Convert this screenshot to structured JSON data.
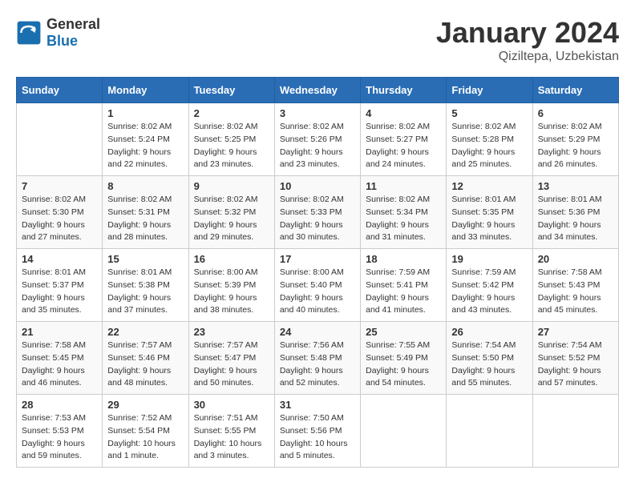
{
  "header": {
    "logo_general": "General",
    "logo_blue": "Blue",
    "month_title": "January 2024",
    "location": "Qiziltepa, Uzbekistan"
  },
  "weekdays": [
    "Sunday",
    "Monday",
    "Tuesday",
    "Wednesday",
    "Thursday",
    "Friday",
    "Saturday"
  ],
  "weeks": [
    [
      null,
      {
        "day": 1,
        "sunrise": "8:02 AM",
        "sunset": "5:24 PM",
        "daylight": "9 hours and 22 minutes."
      },
      {
        "day": 2,
        "sunrise": "8:02 AM",
        "sunset": "5:25 PM",
        "daylight": "9 hours and 23 minutes."
      },
      {
        "day": 3,
        "sunrise": "8:02 AM",
        "sunset": "5:26 PM",
        "daylight": "9 hours and 23 minutes."
      },
      {
        "day": 4,
        "sunrise": "8:02 AM",
        "sunset": "5:27 PM",
        "daylight": "9 hours and 24 minutes."
      },
      {
        "day": 5,
        "sunrise": "8:02 AM",
        "sunset": "5:28 PM",
        "daylight": "9 hours and 25 minutes."
      },
      {
        "day": 6,
        "sunrise": "8:02 AM",
        "sunset": "5:29 PM",
        "daylight": "9 hours and 26 minutes."
      }
    ],
    [
      {
        "day": 7,
        "sunrise": "8:02 AM",
        "sunset": "5:30 PM",
        "daylight": "9 hours and 27 minutes."
      },
      {
        "day": 8,
        "sunrise": "8:02 AM",
        "sunset": "5:31 PM",
        "daylight": "9 hours and 28 minutes."
      },
      {
        "day": 9,
        "sunrise": "8:02 AM",
        "sunset": "5:32 PM",
        "daylight": "9 hours and 29 minutes."
      },
      {
        "day": 10,
        "sunrise": "8:02 AM",
        "sunset": "5:33 PM",
        "daylight": "9 hours and 30 minutes."
      },
      {
        "day": 11,
        "sunrise": "8:02 AM",
        "sunset": "5:34 PM",
        "daylight": "9 hours and 31 minutes."
      },
      {
        "day": 12,
        "sunrise": "8:01 AM",
        "sunset": "5:35 PM",
        "daylight": "9 hours and 33 minutes."
      },
      {
        "day": 13,
        "sunrise": "8:01 AM",
        "sunset": "5:36 PM",
        "daylight": "9 hours and 34 minutes."
      }
    ],
    [
      {
        "day": 14,
        "sunrise": "8:01 AM",
        "sunset": "5:37 PM",
        "daylight": "9 hours and 35 minutes."
      },
      {
        "day": 15,
        "sunrise": "8:01 AM",
        "sunset": "5:38 PM",
        "daylight": "9 hours and 37 minutes."
      },
      {
        "day": 16,
        "sunrise": "8:00 AM",
        "sunset": "5:39 PM",
        "daylight": "9 hours and 38 minutes."
      },
      {
        "day": 17,
        "sunrise": "8:00 AM",
        "sunset": "5:40 PM",
        "daylight": "9 hours and 40 minutes."
      },
      {
        "day": 18,
        "sunrise": "7:59 AM",
        "sunset": "5:41 PM",
        "daylight": "9 hours and 41 minutes."
      },
      {
        "day": 19,
        "sunrise": "7:59 AM",
        "sunset": "5:42 PM",
        "daylight": "9 hours and 43 minutes."
      },
      {
        "day": 20,
        "sunrise": "7:58 AM",
        "sunset": "5:43 PM",
        "daylight": "9 hours and 45 minutes."
      }
    ],
    [
      {
        "day": 21,
        "sunrise": "7:58 AM",
        "sunset": "5:45 PM",
        "daylight": "9 hours and 46 minutes."
      },
      {
        "day": 22,
        "sunrise": "7:57 AM",
        "sunset": "5:46 PM",
        "daylight": "9 hours and 48 minutes."
      },
      {
        "day": 23,
        "sunrise": "7:57 AM",
        "sunset": "5:47 PM",
        "daylight": "9 hours and 50 minutes."
      },
      {
        "day": 24,
        "sunrise": "7:56 AM",
        "sunset": "5:48 PM",
        "daylight": "9 hours and 52 minutes."
      },
      {
        "day": 25,
        "sunrise": "7:55 AM",
        "sunset": "5:49 PM",
        "daylight": "9 hours and 54 minutes."
      },
      {
        "day": 26,
        "sunrise": "7:54 AM",
        "sunset": "5:50 PM",
        "daylight": "9 hours and 55 minutes."
      },
      {
        "day": 27,
        "sunrise": "7:54 AM",
        "sunset": "5:52 PM",
        "daylight": "9 hours and 57 minutes."
      }
    ],
    [
      {
        "day": 28,
        "sunrise": "7:53 AM",
        "sunset": "5:53 PM",
        "daylight": "9 hours and 59 minutes."
      },
      {
        "day": 29,
        "sunrise": "7:52 AM",
        "sunset": "5:54 PM",
        "daylight": "10 hours and 1 minute."
      },
      {
        "day": 30,
        "sunrise": "7:51 AM",
        "sunset": "5:55 PM",
        "daylight": "10 hours and 3 minutes."
      },
      {
        "day": 31,
        "sunrise": "7:50 AM",
        "sunset": "5:56 PM",
        "daylight": "10 hours and 5 minutes."
      },
      null,
      null,
      null
    ]
  ]
}
